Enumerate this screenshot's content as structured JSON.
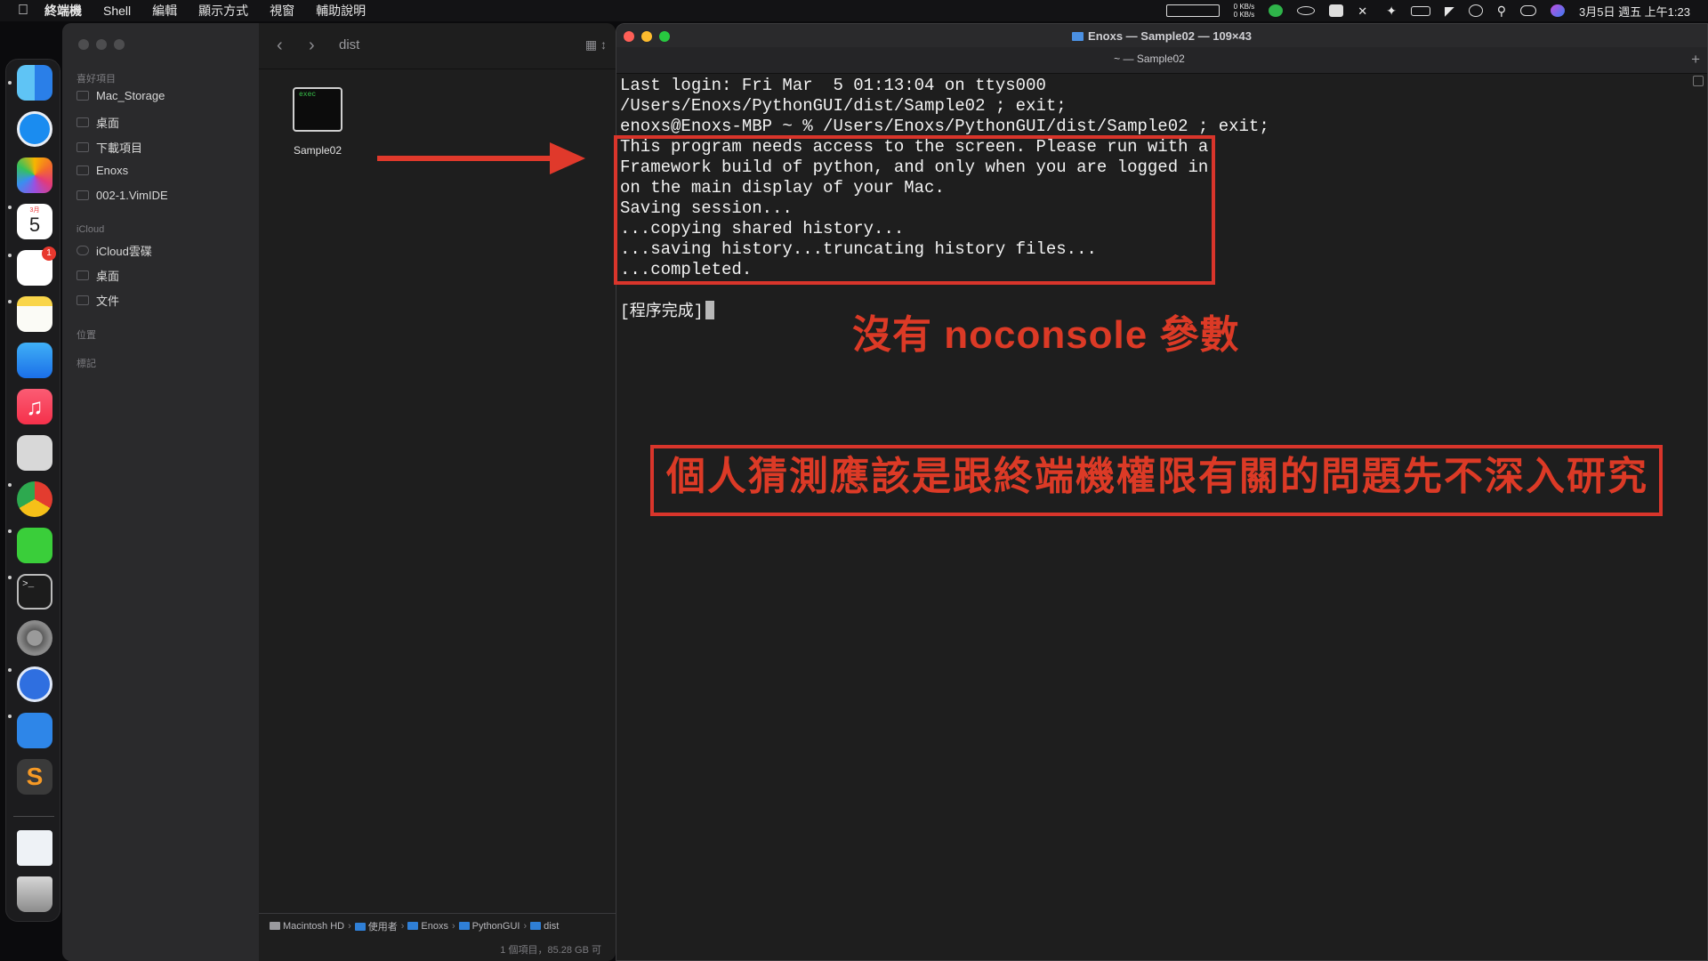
{
  "menubar": {
    "app_name": "終端機",
    "items": [
      "Shell",
      "編輯",
      "顯示方式",
      "視窗",
      "輔助說明"
    ],
    "net_up": "0 KB/s",
    "net_down": "0 KB/s",
    "datetime": "3月5日 週五 上午1:23"
  },
  "dock": {
    "calendar_month": "3月",
    "calendar_day": "5",
    "reminders_badge": "1",
    "icons": [
      "finder-icon",
      "safari-icon",
      "photos-icon",
      "calendar-icon",
      "reminders-icon",
      "notes-icon",
      "mail-icon",
      "music-icon",
      "calculator-icon",
      "chrome-icon",
      "line-icon",
      "terminal-icon",
      "system-preferences-icon",
      "one-password-icon",
      "keynote-icon",
      "sublime-text-icon",
      "zip-archive-icon",
      "trash-icon"
    ]
  },
  "finder": {
    "sidebar": {
      "favorites_label": "喜好項目",
      "favorites": [
        "Mac_Storage",
        "桌面",
        "下載項目",
        "Enoxs",
        "002-1.VimIDE"
      ],
      "icloud_label": "iCloud",
      "icloud": [
        "iCloud雲碟",
        "桌面",
        "文件"
      ],
      "locations_label": "位置",
      "tags_label": "標記"
    },
    "folder_title": "dist",
    "file_icon_text": "exec",
    "file_name": "Sample02",
    "path": [
      "Macintosh HD",
      "使用者",
      "Enoxs",
      "PythonGUI",
      "dist"
    ],
    "status": "1 個項目，85.28 GB 可"
  },
  "terminal": {
    "title": "Enoxs — Sample02 — 109×43",
    "tab_title": "~ — Sample02",
    "new_tab": "+",
    "lines": [
      "Last login: Fri Mar  5 01:13:04 on ttys000",
      "/Users/Enoxs/PythonGUI/dist/Sample02 ; exit;",
      "enoxs@Enoxs-MBP ~ % /Users/Enoxs/PythonGUI/dist/Sample02 ; exit;",
      "This program needs access to the screen. Please run with a",
      "Framework build of python, and only when you are logged in",
      "on the main display of your Mac.",
      "Saving session...",
      "...copying shared history...",
      "...saving history...truncating history files...",
      "...completed.",
      "",
      "[程序完成]"
    ]
  },
  "annotations": {
    "text1": "沒有 noconsole 參數",
    "text2": "個人猜測應該是跟終端機權限有關的問題先不深入研究",
    "color": "#d9352b"
  },
  "colors": {
    "close": "#ff5f57",
    "minimize": "#febc2e",
    "zoom": "#28c840",
    "folder_blue": "#4b90e2"
  }
}
